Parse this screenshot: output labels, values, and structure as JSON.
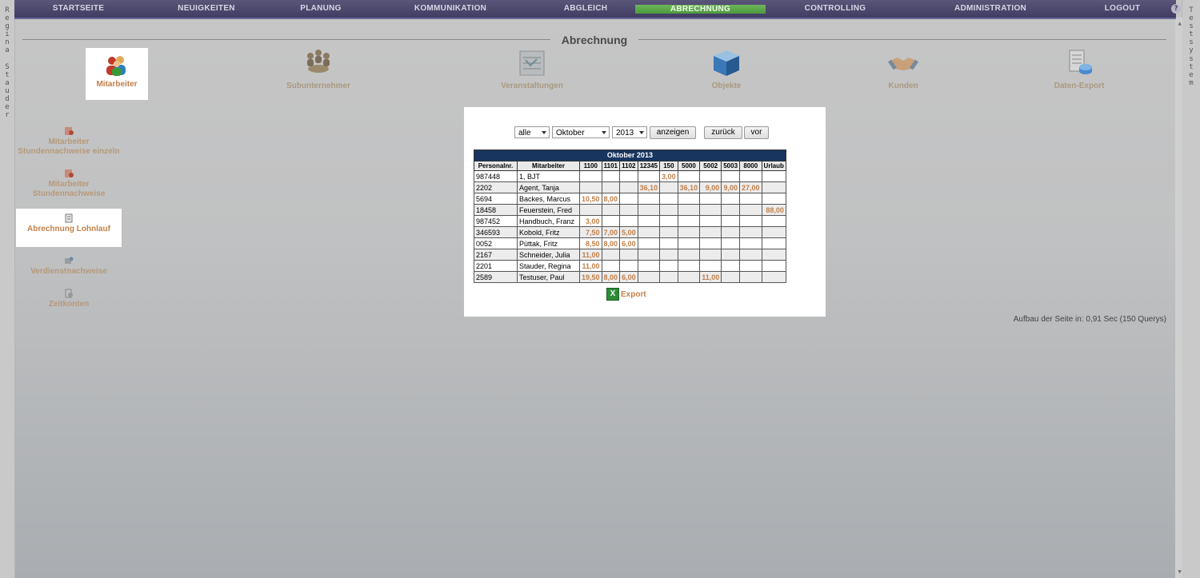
{
  "left_rail": {
    "letters": [
      "R",
      "e",
      "g",
      "i",
      "n",
      "a",
      " ",
      "S",
      "t",
      "a",
      "u",
      "d",
      "e",
      "r"
    ]
  },
  "right_rail": {
    "letters": [
      "T",
      "e",
      "s",
      "t",
      "s",
      "y",
      "s",
      "t",
      "e",
      "m"
    ]
  },
  "nav": {
    "items": [
      "STARTSEITE",
      "NEUIGKEITEN",
      "PLANUNG",
      "KOMMUNIKATION",
      "ABGLEICH",
      "ABRECHNUNG",
      "CONTROLLING",
      "ADMINISTRATION",
      "LOGOUT"
    ],
    "active": "ABRECHNUNG",
    "info_icon": "?"
  },
  "section_title": "Abrechnung",
  "modules": [
    {
      "label": "Mitarbeiter",
      "icon": "people-icon"
    },
    {
      "label": "Subunternehmer",
      "icon": "meeting-icon"
    },
    {
      "label": "Veranstaltungen",
      "icon": "schedule-icon"
    },
    {
      "label": "Objekte",
      "icon": "cube-icon"
    },
    {
      "label": "Kunden",
      "icon": "handshake-icon"
    },
    {
      "label": "Daten-Export",
      "icon": "export-icon"
    }
  ],
  "subnav": [
    {
      "label": "Mitarbeiter Stundennachweise einzeln"
    },
    {
      "label": "Mitarbeiter Stundennachweise"
    },
    {
      "label": "Abrechnung Lohnlauf"
    },
    {
      "label": "Verdienstnachweise"
    },
    {
      "label": "Zeitkonten"
    }
  ],
  "filters": {
    "group": "alle",
    "month": "Oktober",
    "year": "2013",
    "show_label": "anzeigen",
    "back_label": "zurück",
    "next_label": "vor"
  },
  "table": {
    "caption": "Oktober 2013",
    "headers": [
      "Personalnr.",
      "Mitarbeiter",
      "1100",
      "1101",
      "1102",
      "12345",
      "150",
      "5000",
      "5002",
      "5003",
      "8000",
      "Urlaub"
    ],
    "rows": [
      [
        "987448",
        "1, BJT",
        "",
        "",
        "",
        "",
        "3,00",
        "",
        "",
        "",
        "",
        ""
      ],
      [
        "2202",
        "Agent, Tanja",
        "",
        "",
        "",
        "36,10",
        "",
        "36,10",
        "9,00",
        "9,00",
        "27,00",
        ""
      ],
      [
        "5694",
        "Backes, Marcus",
        "10,50",
        "8,00",
        "",
        "",
        "",
        "",
        "",
        "",
        "",
        ""
      ],
      [
        "18458",
        "Feuerstein, Fred",
        "",
        "",
        "",
        "",
        "",
        "",
        "",
        "",
        "",
        "88,00"
      ],
      [
        "987452",
        "Handbuch, Franz",
        "3,00",
        "",
        "",
        "",
        "",
        "",
        "",
        "",
        "",
        ""
      ],
      [
        "346593",
        "Kobold, Fritz",
        "7,50",
        "7,00",
        "5,00",
        "",
        "",
        "",
        "",
        "",
        "",
        ""
      ],
      [
        "0052",
        "Püttak, Fritz",
        "8,50",
        "8,00",
        "6,00",
        "",
        "",
        "",
        "",
        "",
        "",
        ""
      ],
      [
        "2167",
        "Schneider, Julia",
        "11,00",
        "",
        "",
        "",
        "",
        "",
        "",
        "",
        "",
        ""
      ],
      [
        "2201",
        "Stauder, Regina",
        "11,00",
        "",
        "",
        "",
        "",
        "",
        "",
        "",
        "",
        ""
      ],
      [
        "2589",
        "Testuser, Paul",
        "19,50",
        "8,00",
        "6,00",
        "",
        "",
        "",
        "11,00",
        "",
        "",
        ""
      ]
    ]
  },
  "export_label": "Export",
  "footer": "Aufbau der Seite in: 0,91 Sec (150 Querys)"
}
